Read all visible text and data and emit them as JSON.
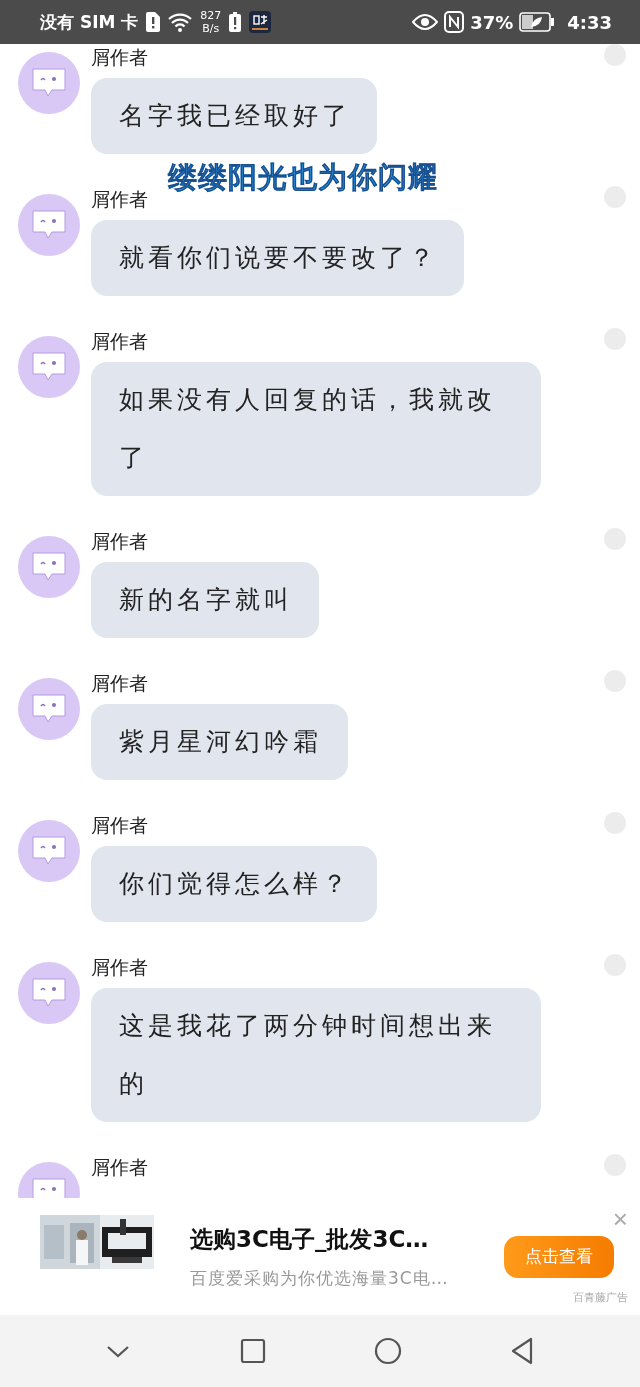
{
  "status_bar": {
    "carrier": "没有 SIM 卡",
    "speed_value": "827",
    "speed_unit": "B/s",
    "battery": "37%",
    "time": "4:33"
  },
  "overlay_caption": "缕缕阳光也为你闪耀",
  "messages": [
    {
      "author": "屑作者",
      "text": "名字我已经取好了"
    },
    {
      "author": "屑作者",
      "text": "就看你们说要不要改了？"
    },
    {
      "author": "屑作者",
      "text": "如果没有人回复的话，我就改了"
    },
    {
      "author": "屑作者",
      "text": "新的名字就叫"
    },
    {
      "author": "屑作者",
      "text": "紫月星河幻吟霜"
    },
    {
      "author": "屑作者",
      "text": "你们觉得怎么样？"
    },
    {
      "author": "屑作者",
      "text": "这是我花了两分钟时间想出来的"
    },
    {
      "author": "屑作者"
    }
  ],
  "ad": {
    "title": "选购3C电子_批发3C…",
    "description": "百度爱采购为你优选海量3C电…",
    "button": "点击查看",
    "source": "百青藤广告",
    "close": "×"
  }
}
